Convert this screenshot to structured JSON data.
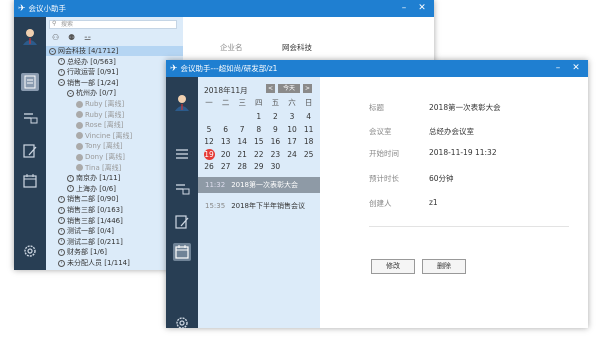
{
  "back_window": {
    "title": "会议小助手",
    "search_placeholder": "搜索",
    "controls": {
      "minimize": "–",
      "close": "✕"
    },
    "detail": {
      "company_label": "企业名",
      "company_value": "网会科技"
    },
    "tree": [
      {
        "indent": 0,
        "toggle": "v",
        "label": "网会科技 [4/1712]",
        "selected": true
      },
      {
        "indent": 1,
        "toggle": ">",
        "label": "总经办 [0/563]"
      },
      {
        "indent": 1,
        "toggle": ">",
        "label": "行政运营 [0/91]"
      },
      {
        "indent": 1,
        "toggle": "v",
        "label": "销售一部 [1/24]"
      },
      {
        "indent": 2,
        "toggle": "v",
        "label": "杭州办 [0/7]"
      },
      {
        "indent": 3,
        "user": true,
        "label": "Ruby [离线]"
      },
      {
        "indent": 3,
        "user": true,
        "label": "Ruby [离线]"
      },
      {
        "indent": 3,
        "user": true,
        "label": "Rose [离线]"
      },
      {
        "indent": 3,
        "user": true,
        "label": "Vincine [离线]"
      },
      {
        "indent": 3,
        "user": true,
        "label": "Tony [离线]"
      },
      {
        "indent": 3,
        "user": true,
        "label": "Dony [离线]"
      },
      {
        "indent": 3,
        "user": true,
        "label": "Tina [离线]"
      },
      {
        "indent": 2,
        "toggle": ">",
        "label": "南京办 [1/11]"
      },
      {
        "indent": 2,
        "toggle": ">",
        "label": "上海办 [0/6]"
      },
      {
        "indent": 1,
        "toggle": ">",
        "label": "销售二部 [0/90]"
      },
      {
        "indent": 1,
        "toggle": ">",
        "label": "销售三部 [0/163]"
      },
      {
        "indent": 1,
        "toggle": ">",
        "label": "销售三部 [1/446]"
      },
      {
        "indent": 1,
        "toggle": ">",
        "label": "测试一部 [0/4]"
      },
      {
        "indent": 1,
        "toggle": ">",
        "label": "测试二部 [0/211]"
      },
      {
        "indent": 1,
        "toggle": ">",
        "label": "财务部 [1/6]"
      },
      {
        "indent": 1,
        "toggle": ">",
        "label": "未分配人员 [1/114]"
      }
    ]
  },
  "front_window": {
    "title": "会议助手---超如尚/研发部/z1",
    "controls": {
      "minimize": "–",
      "close": "✕"
    },
    "calendar": {
      "month_label": "2018年11月",
      "prev": "<",
      "today": "今天",
      "next": ">",
      "weekdays": [
        "一",
        "二",
        "三",
        "四",
        "五",
        "六",
        "日"
      ],
      "weeks": [
        [
          "",
          "",
          "",
          "1",
          "2",
          "3",
          "4"
        ],
        [
          "5",
          "6",
          "7",
          "8",
          "9",
          "10",
          "11"
        ],
        [
          "12",
          "13",
          "14",
          "15",
          "16",
          "17",
          "18"
        ],
        [
          "19",
          "20",
          "21",
          "22",
          "23",
          "24",
          "25"
        ],
        [
          "26",
          "27",
          "28",
          "29",
          "30",
          "",
          ""
        ]
      ],
      "today_day": "19"
    },
    "events": [
      {
        "time": "11:32",
        "title": "2018第一次表彰大会",
        "selected": true
      },
      {
        "time": "15:35",
        "title": "2018年下半年销售会议",
        "selected": false
      }
    ],
    "detail": {
      "title_label": "标题",
      "title_value": "2018第一次表彰大会",
      "room_label": "会议室",
      "room_value": "总经办会议室",
      "start_label": "开始时间",
      "start_value": "2018-11-19 11:32",
      "duration_label": "预计时长",
      "duration_value": "60分钟",
      "creator_label": "创建人",
      "creator_value": "z1"
    },
    "buttons": {
      "edit": "修改",
      "delete": "删除"
    }
  }
}
